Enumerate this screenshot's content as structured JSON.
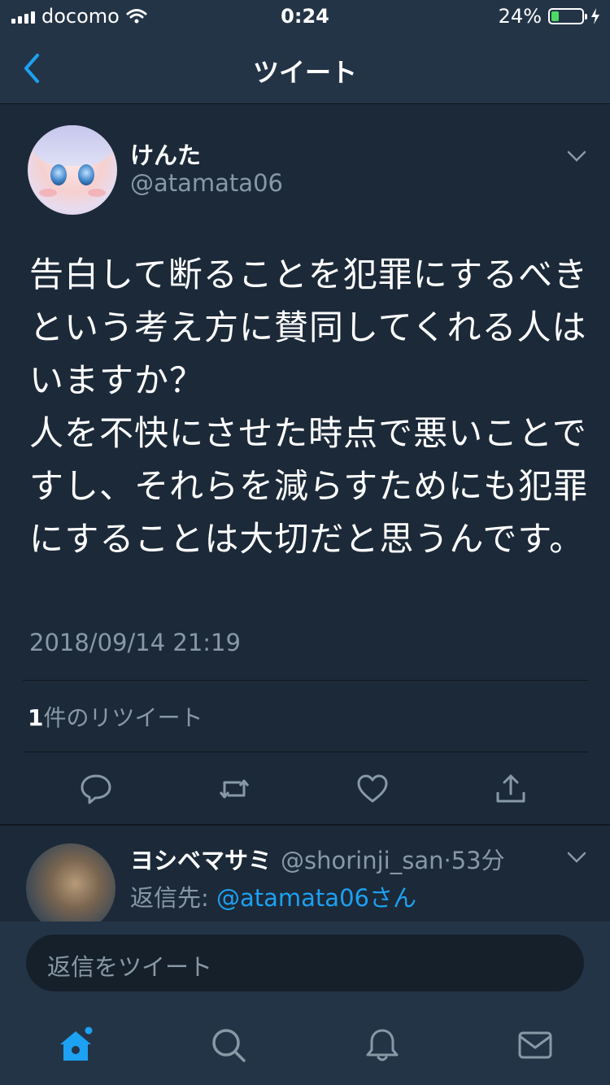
{
  "status_bar": {
    "carrier": "docomo",
    "time": "0:24",
    "battery": "24%",
    "battery_level": 0.24
  },
  "nav": {
    "title": "ツイート",
    "back_icon": "chevron-left-icon"
  },
  "tweet": {
    "author_name": "けんた",
    "author_handle": "@atamata06",
    "text": "告白して断ることを犯罪にするべきという考え方に賛同してくれる人はいますか？\n人を不快にさせた時点で悪いことですし、それらを減らすためにも犯罪にすることは大切だと思うんです。",
    "timestamp": "2018/09/14 21:19",
    "retweet_count": "1",
    "retweet_label": "件のリツイート",
    "actions": [
      "reply-icon",
      "retweet-icon",
      "like-icon",
      "share-icon"
    ]
  },
  "reply": {
    "author_name": "ヨシベマサミ",
    "author_handle": "@shorinji_san",
    "separator": "·",
    "age": "53分",
    "reply_to_label": "返信先: ",
    "reply_to_mention": "@atamata06さん"
  },
  "compose": {
    "placeholder": "返信をツイート"
  },
  "tabs": [
    "home-icon",
    "search-icon",
    "notifications-icon",
    "messages-icon"
  ],
  "colors": {
    "background": "#15202b",
    "card": "#1c2938",
    "bar": "#243447",
    "accent": "#1da1f2",
    "secondary_text": "#8899a6",
    "battery": "#4cd964"
  }
}
